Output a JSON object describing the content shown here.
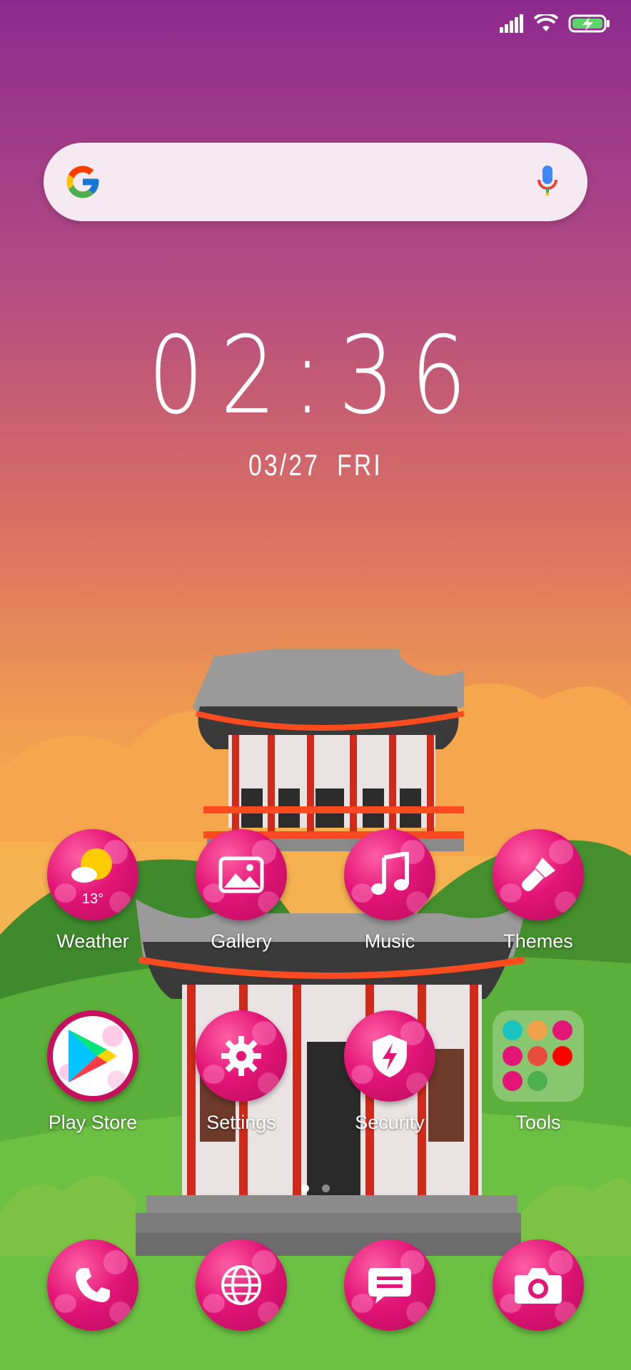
{
  "status_bar": {
    "signal_icon": "signal-icon",
    "wifi_icon": "wifi-icon",
    "battery_icon": "battery-charging-icon"
  },
  "search": {
    "logo_icon": "google-logo-icon",
    "mic_icon": "mic-icon"
  },
  "clock": {
    "time": "02:36",
    "date": "03/27",
    "day": "FRI"
  },
  "home_apps": [
    {
      "label": "Weather",
      "icon": "weather-sun-cloud-icon",
      "extra": "13°"
    },
    {
      "label": "Gallery",
      "icon": "gallery-icon"
    },
    {
      "label": "Music",
      "icon": "music-icon"
    },
    {
      "label": "Themes",
      "icon": "paintbrush-icon"
    },
    {
      "label": "Play Store",
      "icon": "play-store-icon"
    },
    {
      "label": "Settings",
      "icon": "gear-icon"
    },
    {
      "label": "Security",
      "icon": "shield-bolt-icon"
    },
    {
      "label": "Tools",
      "icon": "folder-icon"
    }
  ],
  "page_indicator": {
    "pages": 2,
    "current": 1
  },
  "dock": [
    {
      "icon": "phone-icon"
    },
    {
      "icon": "globe-icon"
    },
    {
      "icon": "message-icon"
    },
    {
      "icon": "camera-icon"
    }
  ],
  "colors": {
    "icon_bg": "#e31577",
    "text": "#ffffff"
  }
}
